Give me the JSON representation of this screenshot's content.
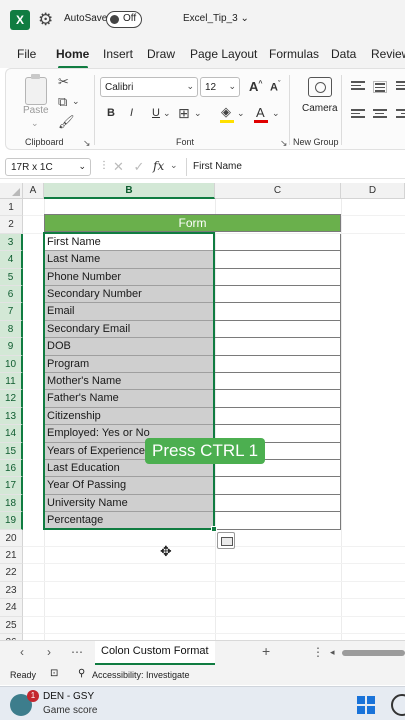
{
  "titlebar": {
    "app_icon": "X",
    "autosave_label": "AutoSave",
    "autosave_state": "Off",
    "filename": "Excel_Tip_3",
    "filename_chevron": "⌄"
  },
  "ribbon_tabs": [
    "File",
    "Home",
    "Insert",
    "Draw",
    "Page Layout",
    "Formulas",
    "Data",
    "Review"
  ],
  "active_tab": "Home",
  "ribbon": {
    "paste_label": "Paste",
    "clipboard_label": "Clipboard",
    "font_name": "Calibri",
    "font_size": "12",
    "grow_font": "A",
    "shrink_font": "A",
    "bold": "B",
    "italic": "I",
    "underline": "U",
    "font_color_letter": "A",
    "font_group_label": "Font",
    "camera_label": "Camera",
    "new_group_label": "New Group",
    "highlight_color": "#ffe000",
    "font_color": "#e00000"
  },
  "formula_bar": {
    "name_box": "17R x 1C",
    "fx": "fx",
    "content": "First Name"
  },
  "grid": {
    "columns": [
      "A",
      "B",
      "C",
      "D"
    ],
    "rows": [
      "1",
      "2",
      "3",
      "4",
      "5",
      "6",
      "7",
      "8",
      "9",
      "10",
      "11",
      "12",
      "13",
      "14",
      "15",
      "16",
      "17",
      "18",
      "19",
      "20",
      "21",
      "22",
      "23",
      "24",
      "25",
      "26"
    ],
    "form_title": "Form",
    "labels": [
      "First Name",
      "Last Name",
      "Phone Number",
      "Secondary Number",
      "Email",
      "Secondary Email",
      "DOB",
      "Program",
      "Mother's Name",
      "Father's Name",
      "Citizenship",
      "Employed: Yes or No",
      "Years of Experience",
      "Last Education",
      "Year Of Passing",
      "University Name",
      "Percentage"
    ],
    "header_color": "#6ab04c",
    "selection_color": "#107c41"
  },
  "overlay_text": "Press CTRL 1",
  "sheet_tabs": {
    "prev": "‹",
    "next": "›",
    "more": "⋯",
    "active_sheet": "Colon Custom Format",
    "add": "+",
    "options": "⋮"
  },
  "statusbar": {
    "ready": "Ready",
    "accessibility": "Accessibility: Investigate"
  },
  "taskbar": {
    "notification_count": "1",
    "score_title": "DEN - GSY",
    "score_subtitle": "Game score"
  }
}
